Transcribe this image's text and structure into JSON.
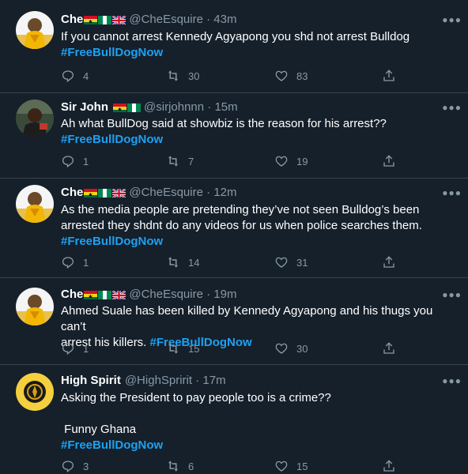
{
  "tweets": [
    {
      "name": "Che",
      "flags": [
        "ghana",
        "nigeria",
        "uk"
      ],
      "handle": "@CheEsquire · 43m",
      "lines": [
        "If you cannot arrest Kennedy Agyapong you shd not arrest Bulldog"
      ],
      "hashtag": "#FreeBullDogNow",
      "replies": "4",
      "retweets": "30",
      "likes": "83",
      "avatar": "yellow-outfit-avatar"
    },
    {
      "name": "Sir John",
      "flags": [
        "ghana",
        "nigeria"
      ],
      "handle": "@sirjohnnn · 15m",
      "lines": [
        "Ah what BullDog said at showbiz is the reason for his arrest??"
      ],
      "hashtag": "#FreeBullDogNow",
      "replies": "1",
      "retweets": "7",
      "likes": "19",
      "avatar": "man-portrait-avatar"
    },
    {
      "name": "Che",
      "flags": [
        "ghana",
        "nigeria",
        "uk"
      ],
      "handle": "@CheEsquire · 12m",
      "lines": [
        "As the media people are pretending they’ve not seen Bulldog’s been",
        "arrested they shdnt do any videos for us when police searches them."
      ],
      "hashtag": "#FreeBullDogNow",
      "replies": "1",
      "retweets": "14",
      "likes": "31",
      "avatar": "yellow-outfit-avatar"
    },
    {
      "name": "Che",
      "flags": [
        "ghana",
        "nigeria",
        "uk"
      ],
      "handle": "@CheEsquire · 19m",
      "lines": [
        "Ahmed Suale has been killed by Kennedy Agyapong and his thugs you can’t",
        "arrest his killers."
      ],
      "hashtag": "#FreeBullDogNow",
      "replies": "1",
      "retweets": "15",
      "likes": "30",
      "avatar": "yellow-outfit-avatar"
    },
    {
      "name": "High Spirit",
      "flags": [],
      "handle": "@HighSpririt · 17m",
      "lines": [
        "Asking the President to pay people too is a crime??",
        "",
        " Funny Ghana"
      ],
      "hashtag": "#FreeBullDogNow",
      "replies": "3",
      "retweets": "6",
      "likes": "15",
      "avatar": "gold-emblem-avatar"
    }
  ],
  "colors": {
    "background": "#15202b",
    "link": "#1da1f2",
    "muted": "#8899a6",
    "divider": "#38444d"
  },
  "icons": [
    "reply-icon",
    "retweet-icon",
    "like-icon",
    "share-icon",
    "more-icon"
  ]
}
